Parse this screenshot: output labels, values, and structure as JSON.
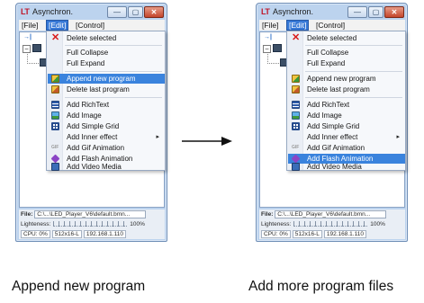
{
  "window": {
    "app_icon": "LT",
    "title": "Asynchron.",
    "min_glyph": "—",
    "max_glyph": "▢",
    "close_glyph": "✕"
  },
  "menubar": {
    "file": "[File]",
    "edit": "[Edit]",
    "control": "[Control]"
  },
  "toolbar": {
    "icon": "→|"
  },
  "tree": {
    "expander": "−"
  },
  "menu_items": [
    "Delete selected",
    "Full Collapse",
    "Full Expand",
    "Append new program",
    "Delete last program",
    "Add RichText",
    "Add Image",
    "Add Simple Grid",
    "Add Inner effect",
    "Add Gif Animation",
    "Add Flash Animation",
    "Add Video Media"
  ],
  "gif_icon_text": "GIF",
  "submenu_arrow": "▸",
  "status": {
    "file_label": "File:",
    "file_value": "C:\\...\\LED_Player_V6\\default.bmn...",
    "lightness_label": "Lighteness:",
    "lightness_value": "100%",
    "cpu_label": "CPU: 0%",
    "resolution": "512x16-L",
    "ip": "192.168.1.110"
  },
  "highlight": {
    "left": "Append new program",
    "right": "Add Flash Animation"
  },
  "captions": {
    "left": "Append new program",
    "right": "Add more program files"
  },
  "colors": {
    "highlight": "#3a83dd",
    "menu_bg": "#f6f8fb",
    "window_frame": "#bcd3ee",
    "close_button": "#c4452b"
  }
}
